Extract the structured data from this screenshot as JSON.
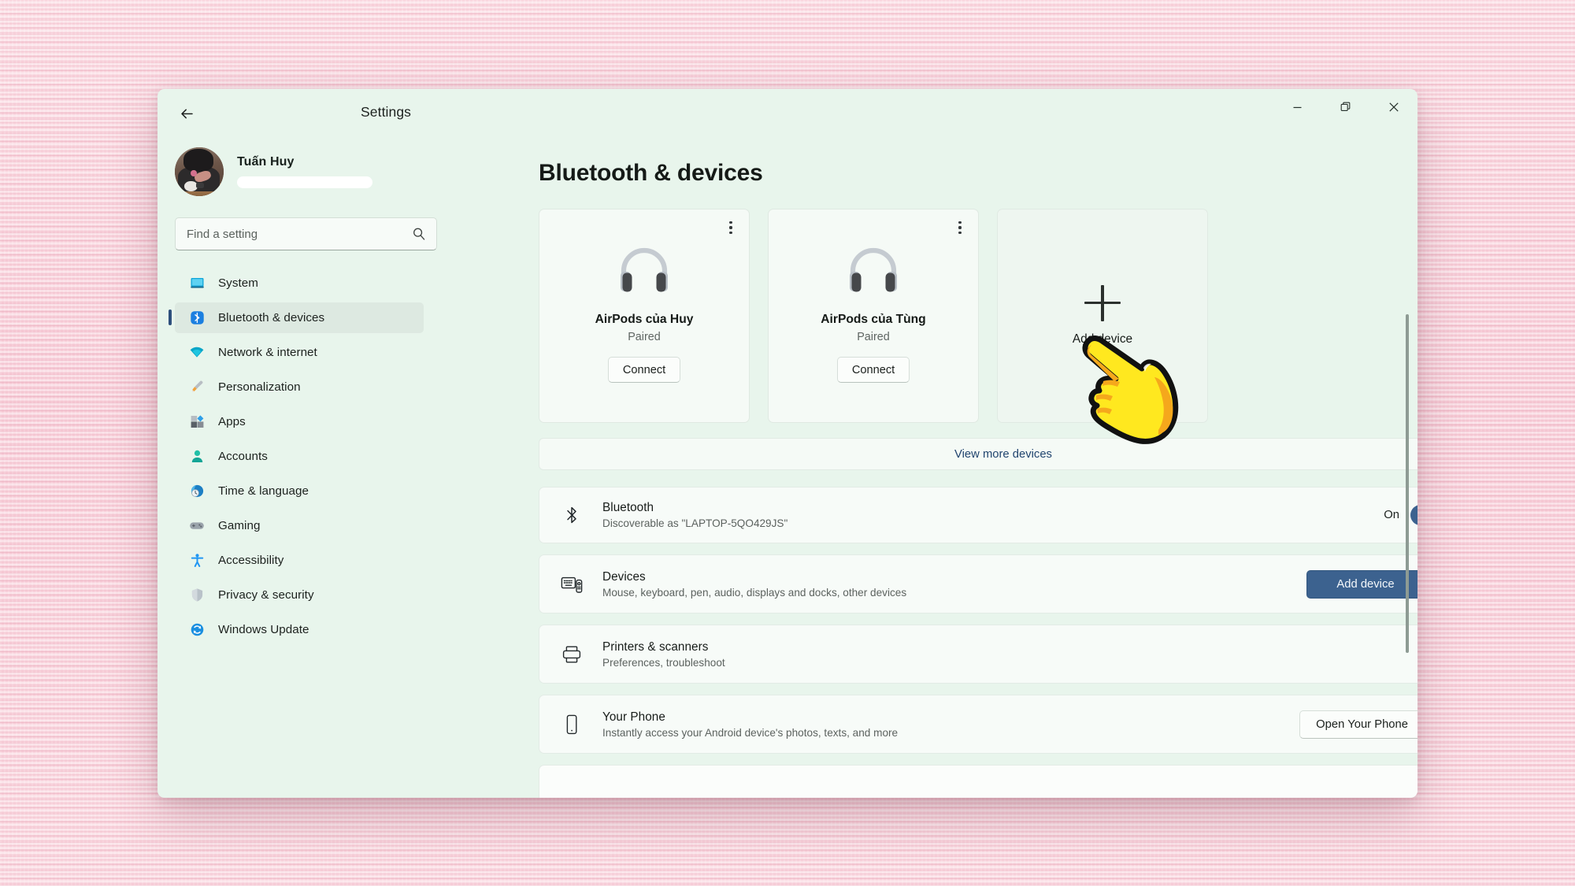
{
  "window": {
    "title": "Settings",
    "back_label": "Back",
    "controls": {
      "minimize": "Minimize",
      "maximize": "Restore",
      "close": "Close"
    }
  },
  "sidebar": {
    "profile": {
      "name": "Tuấn Huy",
      "email_redacted": ""
    },
    "search": {
      "placeholder": "Find a setting",
      "value": ""
    },
    "items": [
      {
        "label": "System",
        "icon": "monitor-icon",
        "active": false
      },
      {
        "label": "Bluetooth & devices",
        "icon": "bluetooth-icon",
        "active": true
      },
      {
        "label": "Network & internet",
        "icon": "wifi-icon",
        "active": false
      },
      {
        "label": "Personalization",
        "icon": "brush-icon",
        "active": false
      },
      {
        "label": "Apps",
        "icon": "apps-icon",
        "active": false
      },
      {
        "label": "Accounts",
        "icon": "person-icon",
        "active": false
      },
      {
        "label": "Time & language",
        "icon": "clock-globe-icon",
        "active": false
      },
      {
        "label": "Gaming",
        "icon": "gamepad-icon",
        "active": false
      },
      {
        "label": "Accessibility",
        "icon": "accessibility-icon",
        "active": false
      },
      {
        "label": "Privacy & security",
        "icon": "shield-icon",
        "active": false
      },
      {
        "label": "Windows Update",
        "icon": "update-icon",
        "active": false
      }
    ]
  },
  "main": {
    "page_title": "Bluetooth & devices",
    "device_cards": [
      {
        "name": "AirPods của Huy",
        "status": "Paired",
        "action": "Connect",
        "icon": "headphones-icon"
      },
      {
        "name": "AirPods của Tùng",
        "status": "Paired",
        "action": "Connect",
        "icon": "headphones-icon"
      }
    ],
    "add_device_tile": {
      "label": "Add device",
      "icon": "plus-icon"
    },
    "view_more": "View more devices",
    "bluetooth": {
      "title": "Bluetooth",
      "subtitle": "Discoverable as \"LAPTOP-5QO429JS\"",
      "toggle_state": "On",
      "toggle_on": true,
      "icon": "bluetooth-icon"
    },
    "rows": [
      {
        "title": "Devices",
        "subtitle": "Mouse, keyboard, pen, audio, displays and docks, other devices",
        "icon": "devices-icon",
        "button": "Add device",
        "button_style": "accent",
        "chevron": true
      },
      {
        "title": "Printers & scanners",
        "subtitle": "Preferences, troubleshoot",
        "icon": "printer-icon",
        "button": "",
        "button_style": "none",
        "chevron": true
      },
      {
        "title": "Your Phone",
        "subtitle": "Instantly access your Android device's photos, texts, and more",
        "icon": "phone-icon",
        "button": "Open Your Phone",
        "button_style": "plain",
        "chevron": true
      }
    ]
  },
  "colors": {
    "window_bg": "#e8f5ec",
    "accent": "#3c628f",
    "link": "#21446f",
    "selection_indicator": "#2d4f7c",
    "desktop": "#f9ced8"
  },
  "cursor": {
    "type": "pointing-hand",
    "color": "#ffe81f"
  }
}
